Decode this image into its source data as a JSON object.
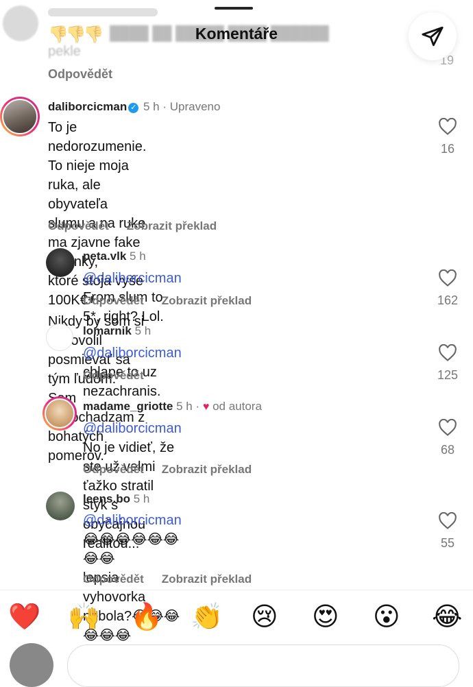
{
  "header": {
    "title": "Komentáře"
  },
  "faded_comment": {
    "text_line2": "pekle",
    "reply": "Odpovědět",
    "likes": "19"
  },
  "comments": [
    {
      "username": "daliborcicman",
      "time": "5 h",
      "edited": "· Upraveno",
      "text_p1_l1": "To je nedorozumenie. To nieje moja ruka, ale",
      "text_p1_l2": "obyvateľa slumu a na ruke ma zjavne fake hodinky,",
      "text_p1_l3": "ktoré stoja vyše 100K€+.",
      "text_p2_l1": "Nikdy by som si nedovolil posmievať sa tým ľudom.",
      "text_p2_l2": "Sam nepochadzam z bohatých pomerov.",
      "reply": "Odpovědět",
      "translate": "Zobrazit překlad",
      "likes": "16"
    },
    {
      "username": "peta.vlk",
      "time": "5 h",
      "mention": "@daliborcicman",
      "text": "From slum to 5*, right? Lol.",
      "reply": "Odpovědět",
      "translate": "Zobrazit překlad",
      "likes": "162"
    },
    {
      "username": "lomarnik",
      "time": "5 h",
      "mention": "@daliborcicman",
      "text": "chlape to uz nezachranis.",
      "reply": "Odpovědět",
      "likes": "125"
    },
    {
      "username": "madame_griotte",
      "time": "5 h ·",
      "by_author": "od autora",
      "mention": "@daliborcicman",
      "text_l1": "No je vidieť, že ste už velmi",
      "text_l2": "ťažko stratil styk s obyčajnou realitou...",
      "reply": "Odpovědět",
      "translate": "Zobrazit překlad",
      "likes": "68"
    },
    {
      "username": "leens.bo",
      "time": "5 h",
      "mention": "@daliborcicman",
      "emoji_l1": "😂😂😂😂😂😂😂😂",
      "text_l2": "lepsia vyhovorka nebola?",
      "emoji_l2": "😂😂😂😂😂😂",
      "emoji_l3": "😂",
      "reply": "Odpovědět",
      "translate": "Zobrazit překlad",
      "likes": "55"
    }
  ],
  "quick_emojis": [
    "❤️",
    "🙌",
    "🔥",
    "👏",
    "😢",
    "😍",
    "😮",
    "😂"
  ]
}
